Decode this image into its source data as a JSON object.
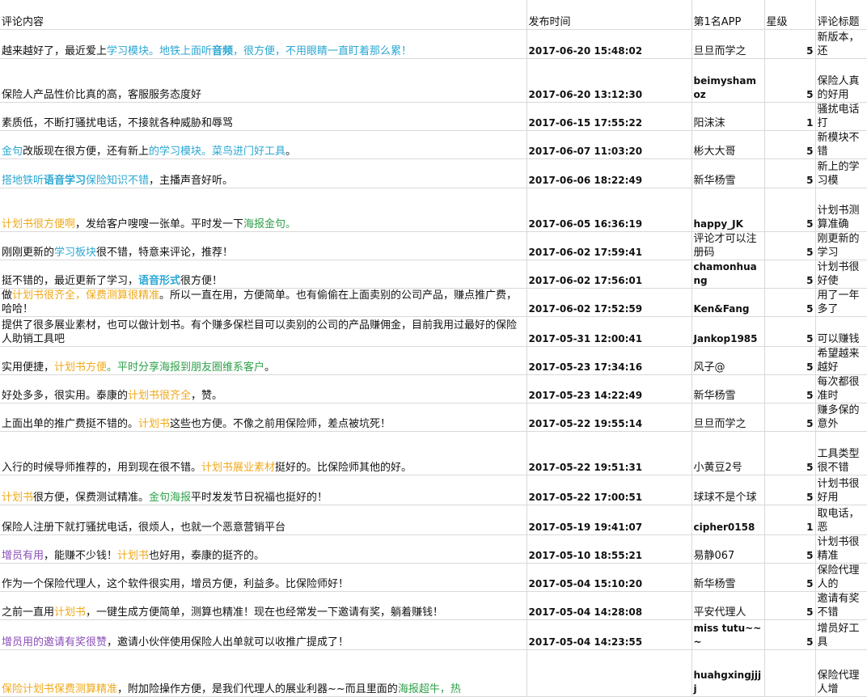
{
  "colors": {
    "blue": "#2aa7d3",
    "orange": "#f0a91b",
    "green": "#2fa04a",
    "purple": "#8a4fb8",
    "text": "#111111",
    "grid": "#d9d9d9"
  },
  "headers": {
    "content": "评论内容",
    "time": "发布时间",
    "app_rank": "第1名APP",
    "stars": "星级",
    "title": "评论标题"
  },
  "rows": [
    {
      "segs": [
        {
          "t": "越来越好了，最近爱上",
          "c": "text"
        },
        {
          "t": "学习模块。地铁上面听",
          "c": "blue"
        },
        {
          "t": "音频",
          "c": "blue",
          "b": true
        },
        {
          "t": "，很方便，不用眼睛一直盯着那么累！",
          "c": "blue"
        }
      ],
      "time": "2017-06-20 15:48:02",
      "user": "旦旦而学之",
      "ub": false,
      "stars": "5",
      "title": "新版本，还"
    },
    {
      "segs": [
        {
          "t": "保险人产品性价比真的高，客服服务态度好",
          "c": "text"
        }
      ],
      "time": "2017-06-20 13:12:30",
      "user": "beimyshamoz",
      "ub": true,
      "stars": "5",
      "title": "保险人真的好用"
    },
    {
      "segs": [
        {
          "t": "素质低，不断打骚扰电话，不接就各种威胁和辱骂",
          "c": "text"
        }
      ],
      "time": "2017-06-15 17:55:22",
      "user": "阳沫沫",
      "ub": false,
      "stars": "1",
      "title": "骚扰电话打"
    },
    {
      "segs": [
        {
          "t": "金句",
          "c": "blue"
        },
        {
          "t": "改版现在很方便，还有新上",
          "c": "text"
        },
        {
          "t": "的学习模块。菜鸟进门好工具",
          "c": "blue"
        },
        {
          "t": "。",
          "c": "text"
        }
      ],
      "time": "2017-06-07 11:03:20",
      "user": "彬大大哥",
      "ub": false,
      "stars": "5",
      "title": "新模块不错"
    },
    {
      "segs": [
        {
          "t": "搭地铁听",
          "c": "blue"
        },
        {
          "t": "语音学习",
          "c": "blue",
          "b": true
        },
        {
          "t": "保险知识不错",
          "c": "blue"
        },
        {
          "t": "，主播声音好听。",
          "c": "text"
        }
      ],
      "time": "2017-06-06 18:22:49",
      "user": "新华杨雪",
      "ub": false,
      "stars": "5",
      "title": "新上的学习模"
    },
    {
      "segs": [
        {
          "t": "计划书很方便啊",
          "c": "orange"
        },
        {
          "t": "，发给客户嗖嗖一张单。平时发一下",
          "c": "text"
        },
        {
          "t": "海报金句。",
          "c": "green"
        }
      ],
      "time": "2017-06-05 16:36:19",
      "user": "happy_JK",
      "ub": true,
      "stars": "5",
      "title": "计划书测算准确"
    },
    {
      "segs": [
        {
          "t": "刚刚更新的",
          "c": "text"
        },
        {
          "t": "学习板块",
          "c": "blue"
        },
        {
          "t": "很不错，特意来评论，推荐！",
          "c": "text"
        }
      ],
      "time": "2017-06-02 17:59:41",
      "user": "评论才可以注册码",
      "ub": false,
      "stars": "5",
      "title": "刚更新的学习"
    },
    {
      "segs": [
        {
          "t": "挺不错的，最近更新了学习，",
          "c": "text"
        },
        {
          "t": "语音形式",
          "c": "blue",
          "b": true
        },
        {
          "t": "很方便！",
          "c": "text"
        }
      ],
      "time": "2017-06-02 17:56:01",
      "user": "chamonhuang",
      "ub": true,
      "stars": "5",
      "title": "计划书很好使"
    },
    {
      "segs": [
        {
          "t": "做",
          "c": "text"
        },
        {
          "t": "计划书很齐全，保费测算很精准",
          "c": "orange"
        },
        {
          "t": "。所以一直在用，方便简单。也有偷偷在上面卖别的公司产品，赚点推广费，哈哈！",
          "c": "text"
        }
      ],
      "time": "2017-06-02 17:52:59",
      "user": "Ken&Fang",
      "ub": true,
      "stars": "5",
      "title": "用了一年多了"
    },
    {
      "segs": [
        {
          "t": "提供了很多展业素材，也可以做计划书。有个赚多保栏目可以卖别的公司的产品赚佣金，目前我用过最好的保险人助销工具吧",
          "c": "text"
        }
      ],
      "time": "2017-05-31 12:00:41",
      "user": "Jankop1985",
      "ub": true,
      "stars": "5",
      "title": "可以赚钱"
    },
    {
      "segs": [
        {
          "t": "实用便捷，",
          "c": "text"
        },
        {
          "t": "计划书方便",
          "c": "orange"
        },
        {
          "t": "。平时分享海报到朋友圈维系客户",
          "c": "green"
        },
        {
          "t": "。",
          "c": "text"
        }
      ],
      "time": "2017-05-23 17:34:16",
      "user": "风子@",
      "ub": false,
      "stars": "5",
      "title": "希望越来越好"
    },
    {
      "segs": [
        {
          "t": "好处多多，很实用。泰康的",
          "c": "text"
        },
        {
          "t": "计划书很齐全",
          "c": "orange"
        },
        {
          "t": "，赞。",
          "c": "text"
        }
      ],
      "time": "2017-05-23 14:22:49",
      "user": "新华杨雪",
      "ub": false,
      "stars": "5",
      "title": "每次都很准时"
    },
    {
      "segs": [
        {
          "t": "上面出单的推广费挺不错的。",
          "c": "text"
        },
        {
          "t": "计划书",
          "c": "orange"
        },
        {
          "t": "这些也方便。不像之前用保险师，差点被坑死！",
          "c": "text"
        }
      ],
      "time": "2017-05-22 19:55:14",
      "user": "旦旦而学之",
      "ub": false,
      "stars": "5",
      "title": "赚多保的意外"
    },
    {
      "segs": [
        {
          "t": "入行的时候导师推荐的，用到现在很不错。",
          "c": "text"
        },
        {
          "t": "计划书展业素材",
          "c": "orange"
        },
        {
          "t": "挺好的。比保险师其他的好。",
          "c": "text"
        }
      ],
      "time": "2017-05-22 19:51:31",
      "user": "小黄豆2号",
      "ub": false,
      "stars": "5",
      "title": "工具类型很不错"
    },
    {
      "segs": [
        {
          "t": "计划书",
          "c": "orange"
        },
        {
          "t": "很方便，保费测试精准。",
          "c": "text"
        },
        {
          "t": "金句海报",
          "c": "green"
        },
        {
          "t": "平时发发节日祝福也挺好的！",
          "c": "text"
        }
      ],
      "time": "2017-05-22 17:00:51",
      "user": "球球不是个球",
      "ub": false,
      "stars": "5",
      "title": "计划书很好用"
    },
    {
      "segs": [
        {
          "t": "保险人注册下就打骚扰电话，很烦人，也就一个恶意营销平台",
          "c": "text"
        }
      ],
      "time": "2017-05-19 19:41:07",
      "user": "cipher0158",
      "ub": true,
      "stars": "1",
      "title": "取电话，恶"
    },
    {
      "segs": [
        {
          "t": "增员有用",
          "c": "purple"
        },
        {
          "t": "，能赚不少钱！",
          "c": "text"
        },
        {
          "t": "计划书",
          "c": "orange"
        },
        {
          "t": "也好用，泰康的挺齐的。",
          "c": "text"
        }
      ],
      "time": "2017-05-10 18:55:21",
      "user": "易静067",
      "ub": false,
      "stars": "5",
      "title": "计划书很精准"
    },
    {
      "segs": [
        {
          "t": "作为一个保险代理人，这个软件很实用，增员方便，利益多。比保险师好！",
          "c": "text"
        }
      ],
      "time": "2017-05-04 15:10:20",
      "user": "新华杨雪",
      "ub": false,
      "stars": "5",
      "title": "保险代理人的"
    },
    {
      "segs": [
        {
          "t": "之前一直用",
          "c": "text"
        },
        {
          "t": "计划书",
          "c": "orange"
        },
        {
          "t": "，一键生成方便简单，测算也精准！现在也经常发一下邀请有奖，躺着赚钱！",
          "c": "text"
        }
      ],
      "time": "2017-05-04 14:28:08",
      "user": "平安代理人",
      "ub": false,
      "stars": "5",
      "title": "邀请有奖不错"
    },
    {
      "segs": [
        {
          "t": "增员用的邀请有奖很赞",
          "c": "purple"
        },
        {
          "t": "，邀请小伙伴使用保险人出单就可以收推广提成了！",
          "c": "text"
        }
      ],
      "time": "2017-05-04 14:23:55",
      "user": "miss tutu~~~",
      "ub": true,
      "stars": "5",
      "title": "增员好工具"
    },
    {
      "segs": [
        {
          "t": "保险计划书保费测算精准",
          "c": "orange"
        },
        {
          "t": "，附加险操作方便，是我们代理人的展业利器~~而且里面的",
          "c": "text"
        },
        {
          "t": "海报超牛，热",
          "c": "green"
        }
      ],
      "time": "",
      "user": "huahgxingjjjj",
      "ub": true,
      "stars": "",
      "title": "保险代理人增"
    }
  ]
}
